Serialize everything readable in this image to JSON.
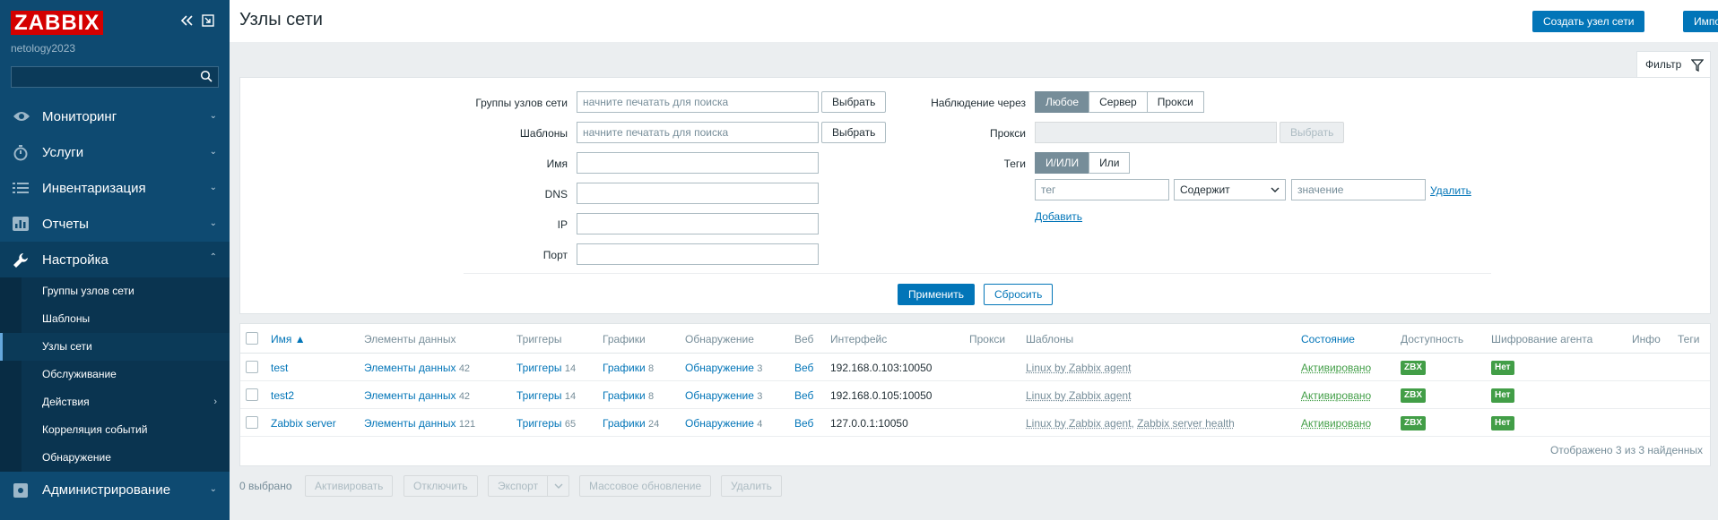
{
  "sidebar": {
    "logo": "ZABBIX",
    "server_name": "netology2023",
    "collapse_icon": "double-chevron-left-icon",
    "kiosk_icon": "kiosk-icon",
    "menu": [
      {
        "label": "Мониторинг",
        "icon": "eye-icon"
      },
      {
        "label": "Услуги",
        "icon": "clock-icon"
      },
      {
        "label": "Инвентаризация",
        "icon": "list-icon"
      },
      {
        "label": "Отчеты",
        "icon": "bar-chart-icon"
      },
      {
        "label": "Настройка",
        "icon": "wrench-icon"
      },
      {
        "label": "Администрирование",
        "icon": "gear-icon"
      }
    ],
    "submenu": [
      {
        "label": "Группы узлов сети"
      },
      {
        "label": "Шаблоны"
      },
      {
        "label": "Узлы сети"
      },
      {
        "label": "Обслуживание"
      },
      {
        "label": "Действия"
      },
      {
        "label": "Корреляция событий"
      },
      {
        "label": "Обнаружение"
      }
    ]
  },
  "header": {
    "title": "Узлы сети",
    "create_button": "Создать узел сети",
    "import_button": "Импорт"
  },
  "filter": {
    "tab_label": "Фильтр",
    "host_groups_label": "Группы узлов сети",
    "host_groups_placeholder": "начните печатать для поиска",
    "templates_label": "Шаблоны",
    "templates_placeholder": "начните печатать для поиска",
    "select_button": "Выбрать",
    "name_label": "Имя",
    "dns_label": "DNS",
    "ip_label": "IP",
    "port_label": "Порт",
    "monitored_by_label": "Наблюдение через",
    "monitored_by_options": [
      "Любое",
      "Сервер",
      "Прокси"
    ],
    "proxy_label": "Прокси",
    "tags_label": "Теги",
    "tags_options": [
      "И/ИЛИ",
      "Или"
    ],
    "tag_placeholder": "тег",
    "tag_operator": "Содержит",
    "value_placeholder": "значение",
    "remove_link": "Удалить",
    "add_link": "Добавить",
    "apply_button": "Применить",
    "reset_button": "Сбросить"
  },
  "table": {
    "columns": [
      "Имя ▲",
      "Элементы данных",
      "Триггеры",
      "Графики",
      "Обнаружение",
      "Веб",
      "Интерфейс",
      "Прокси",
      "Шаблоны",
      "Состояние",
      "Доступность",
      "Шифрование агента",
      "Инфо",
      "Теги"
    ],
    "rows": [
      {
        "name": "test",
        "items": "Элементы данных",
        "items_count": "42",
        "triggers": "Триггеры",
        "triggers_count": "14",
        "graphs": "Графики",
        "graphs_count": "8",
        "discovery": "Обнаружение",
        "discovery_count": "3",
        "web": "Веб",
        "interface": "192.168.0.103:10050",
        "templates": "Linux by Zabbix agent",
        "templates2": "",
        "status": "Активировано",
        "availability": "ZBX",
        "encryption": "Нет"
      },
      {
        "name": "test2",
        "items": "Элементы данных",
        "items_count": "42",
        "triggers": "Триггеры",
        "triggers_count": "14",
        "graphs": "Графики",
        "graphs_count": "8",
        "discovery": "Обнаружение",
        "discovery_count": "3",
        "web": "Веб",
        "interface": "192.168.0.105:10050",
        "templates": "Linux by Zabbix agent",
        "templates2": "",
        "status": "Активировано",
        "availability": "ZBX",
        "encryption": "Нет"
      },
      {
        "name": "Zabbix server",
        "items": "Элементы данных",
        "items_count": "121",
        "triggers": "Триггеры",
        "triggers_count": "65",
        "graphs": "Графики",
        "graphs_count": "24",
        "discovery": "Обнаружение",
        "discovery_count": "4",
        "web": "Веб",
        "interface": "127.0.0.1:10050",
        "templates": "Linux by Zabbix agent",
        "templates2": "Zabbix server health",
        "status": "Активировано",
        "availability": "ZBX",
        "encryption": "Нет"
      }
    ],
    "footer": "Отображено 3 из 3 найденных"
  },
  "bottom": {
    "selected": "0 выбрано",
    "enable": "Активировать",
    "disable": "Отключить",
    "export": "Экспорт",
    "mass_update": "Массовое обновление",
    "delete": "Удалить"
  },
  "colors": {
    "sidebar": "#0e4a71",
    "accent": "#0275b8",
    "status_green": "#429e47",
    "logo_red": "#d40000"
  }
}
